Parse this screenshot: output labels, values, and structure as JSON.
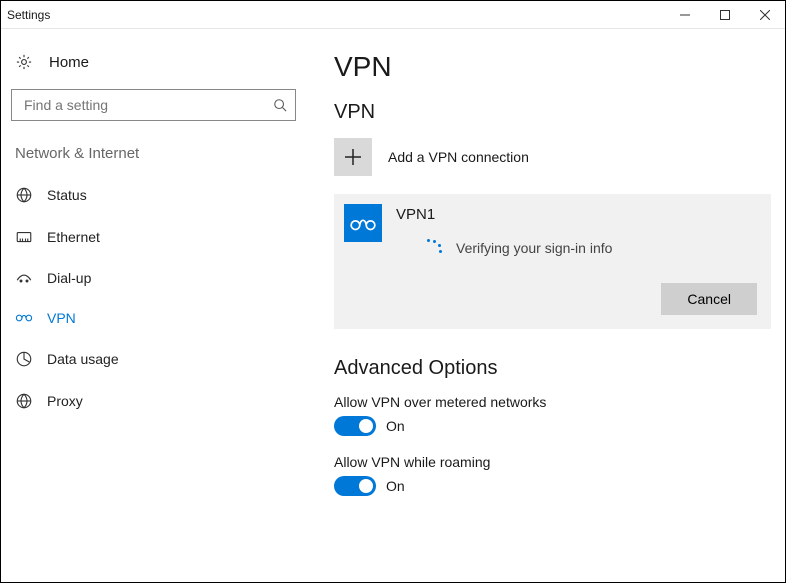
{
  "window": {
    "title": "Settings"
  },
  "sidebar": {
    "home": "Home",
    "search_placeholder": "Find a setting",
    "category": "Network & Internet",
    "items": [
      {
        "label": "Status"
      },
      {
        "label": "Ethernet"
      },
      {
        "label": "Dial-up"
      },
      {
        "label": "VPN"
      },
      {
        "label": "Data usage"
      },
      {
        "label": "Proxy"
      }
    ]
  },
  "main": {
    "title": "VPN",
    "section": "VPN",
    "add_label": "Add a VPN connection",
    "vpn": {
      "name": "VPN1",
      "status": "Verifying your sign-in info",
      "cancel": "Cancel"
    },
    "advanced": {
      "title": "Advanced Options",
      "opt1_label": "Allow VPN over metered networks",
      "opt1_state": "On",
      "opt2_label": "Allow VPN while roaming",
      "opt2_state": "On"
    }
  }
}
